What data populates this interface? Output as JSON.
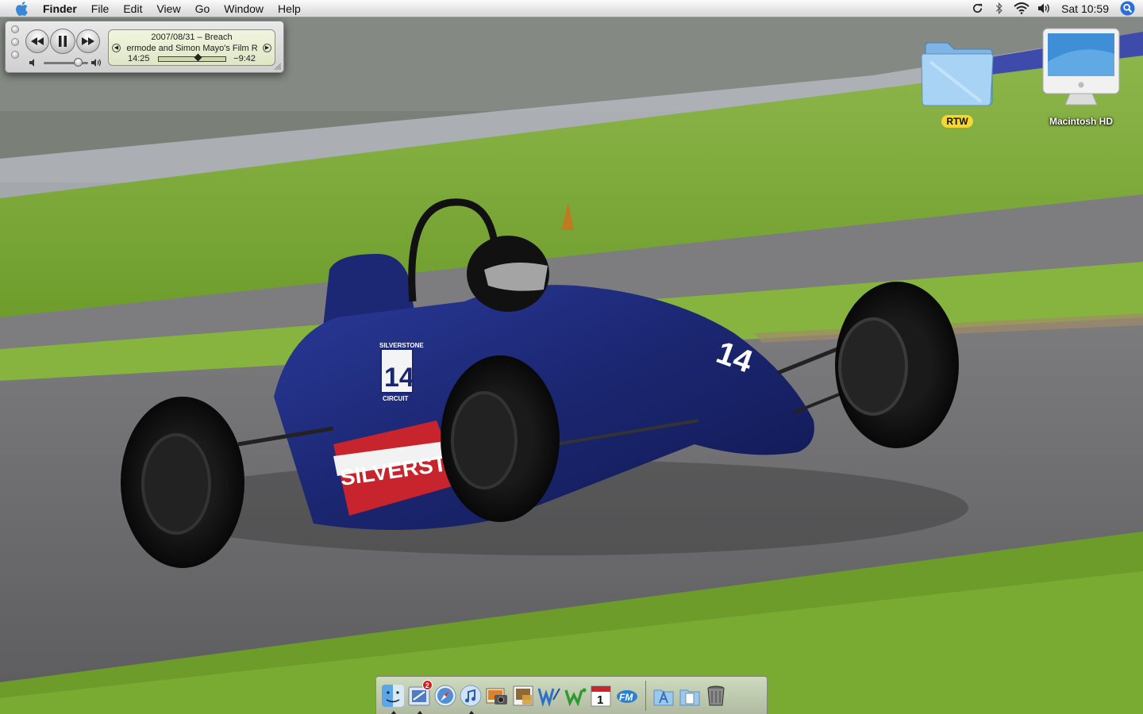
{
  "menubar": {
    "app_name": "Finder",
    "menus": [
      "File",
      "Edit",
      "View",
      "Go",
      "Window",
      "Help"
    ],
    "status_icons": [
      "sync-icon",
      "bluetooth-icon",
      "wifi-icon",
      "volume-icon"
    ],
    "clock": "Sat 10:59",
    "spotlight_icon": "spotlight-icon"
  },
  "miniplayer": {
    "title_line": "2007/08/31 – Breach",
    "subtitle_line": "ermode and Simon Mayo's Film R",
    "elapsed": "14:25",
    "remaining": "−9:42",
    "progress_fraction": 0.6
  },
  "desktop": {
    "icons": [
      {
        "label": "RTW",
        "icon": "folder-icon",
        "label_color": "#f6d630"
      },
      {
        "label": "Macintosh HD",
        "icon": "imac-icon"
      }
    ]
  },
  "dock": {
    "items": [
      {
        "name": "finder",
        "icon": "finder-icon",
        "running": true
      },
      {
        "name": "mail",
        "icon": "mail-icon",
        "badge": "2",
        "running": true
      },
      {
        "name": "safari",
        "icon": "safari-icon"
      },
      {
        "name": "itunes",
        "icon": "itunes-icon",
        "running": true
      },
      {
        "name": "iphoto",
        "icon": "iphoto-icon"
      },
      {
        "name": "preview",
        "icon": "preview-icon"
      },
      {
        "name": "word",
        "icon": "word-icon"
      },
      {
        "name": "wire-app",
        "icon": "w-green-icon"
      },
      {
        "name": "ical",
        "icon": "ical-icon",
        "date": "1"
      },
      {
        "name": "fm",
        "icon": "fm-icon",
        "text": "FM"
      },
      {
        "name": "applications",
        "icon": "applications-folder-icon"
      },
      {
        "name": "documents",
        "icon": "documents-folder-icon"
      },
      {
        "name": "trash",
        "icon": "trash-icon"
      }
    ]
  },
  "wallpaper": {
    "car_number": "14",
    "car_side_text": "SILVERSTONE",
    "car_badge_text": "SILVERSTONE",
    "car_badge_sub": "CIRCUIT",
    "colors": {
      "grass": "#7aa83a",
      "track": "#6f6f70",
      "car_body": "#1e2b7a"
    }
  }
}
